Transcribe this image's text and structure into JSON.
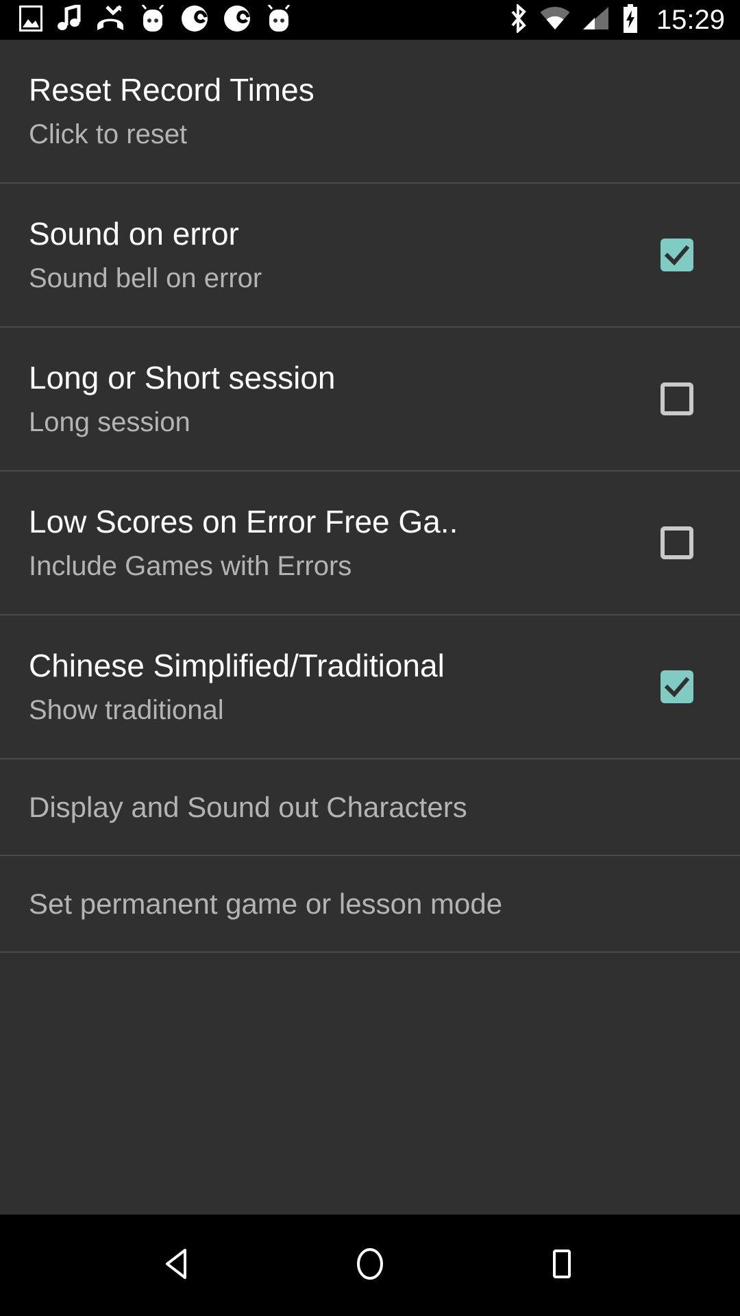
{
  "status_bar": {
    "left_icons": [
      {
        "name": "image-icon"
      },
      {
        "name": "music-note-icon"
      },
      {
        "name": "missed-call-icon"
      },
      {
        "name": "android-head-icon"
      },
      {
        "name": "eclipse-e-icon"
      },
      {
        "name": "eclipse-e-icon"
      },
      {
        "name": "android-head-icon"
      }
    ],
    "right_icons": [
      {
        "name": "bluetooth-icon"
      },
      {
        "name": "wifi-icon"
      },
      {
        "name": "cell-signal-icon"
      },
      {
        "name": "battery-charging-icon"
      }
    ],
    "time": "15:29"
  },
  "settings": {
    "rows": [
      {
        "title": "Reset Record Times",
        "summary": "Click to reset",
        "has_checkbox": false,
        "checked": false
      },
      {
        "title": "Sound on error",
        "summary": "Sound bell on error",
        "has_checkbox": true,
        "checked": true
      },
      {
        "title": "Long or Short session",
        "summary": "Long session",
        "has_checkbox": true,
        "checked": false
      },
      {
        "title": "Low Scores on Error Free Ga..",
        "summary": "Include Games with Errors",
        "has_checkbox": true,
        "checked": false
      },
      {
        "title": "Chinese Simplified/Traditional",
        "summary": "Show traditional",
        "has_checkbox": true,
        "checked": true
      },
      {
        "title": "Display and Sound out Characters",
        "summary": "",
        "has_checkbox": false,
        "checked": false
      },
      {
        "title": "Set permanent game or lesson mode",
        "summary": "",
        "has_checkbox": false,
        "checked": false
      }
    ]
  },
  "nav_bar": {
    "buttons": [
      {
        "name": "back-button"
      },
      {
        "name": "home-button"
      },
      {
        "name": "recents-button"
      }
    ]
  },
  "colors": {
    "background": "#303030",
    "status_bar_bg": "#000000",
    "divider": "#4a4a4a",
    "title_text": "#ffffff",
    "summary_text": "#b4b4b4",
    "checkbox_accent": "#80cbc4",
    "checkbox_outline": "#c9c9c9"
  }
}
